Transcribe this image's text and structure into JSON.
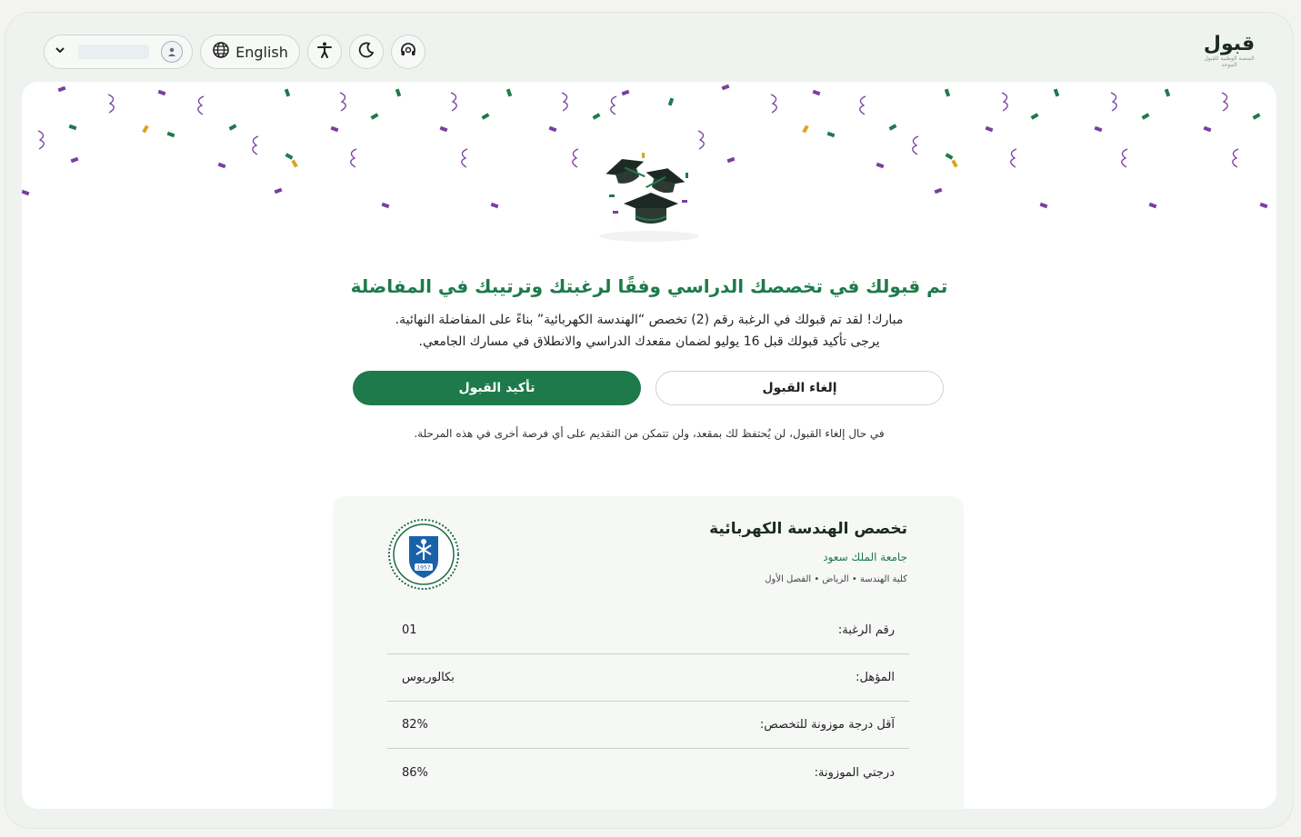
{
  "header": {
    "language_label": "English",
    "logo_text": "قبول",
    "logo_subtitle": "المنصة الوطنية للقبول الموحد"
  },
  "hero": {
    "headline": "تم قبولك في تخصصك الدراسي وفقًا لرغبتك وترتيبك في المفاضلة",
    "line1": "مبارك! لقد تم قبولك في الرغبة رقم (2) تخصص “الهندسة الكهربائية” بناءً على المفاضلة النهائية.",
    "line2": "يرجى تأكيد قبولك قبل 16 يوليو لضمان مقعدك الدراسي والانطلاق في مسارك الجامعي."
  },
  "actions": {
    "confirm_label": "تأكيد القبول",
    "cancel_label": "إلغاء القبول",
    "note": "في حال إلغاء القبول، لن يُحتفظ لك بمقعد، ولن تتمكن من التقديم على أي فرصة أخرى في هذه المرحلة."
  },
  "card": {
    "title": "تخصص الهندسة الكهربائية",
    "university": "جامعة الملك سعود",
    "meta": "كلية الهندسة • الرياض • الفصل الأول",
    "seal_year": "1957",
    "rows": [
      {
        "label": "رقم الرغبة:",
        "value": "01"
      },
      {
        "label": "المؤهل:",
        "value": "بكالوريوس"
      },
      {
        "label": "آقل درجة موزونة للتخصص:",
        "value": "82%"
      },
      {
        "label": "درجتي الموزونة:",
        "value": "86%"
      }
    ]
  },
  "colors": {
    "primary": "#1e7a4a",
    "confetti_purple": "#7a3fa0",
    "confetti_green": "#1e7a4a",
    "confetti_gold": "#d9a520"
  }
}
